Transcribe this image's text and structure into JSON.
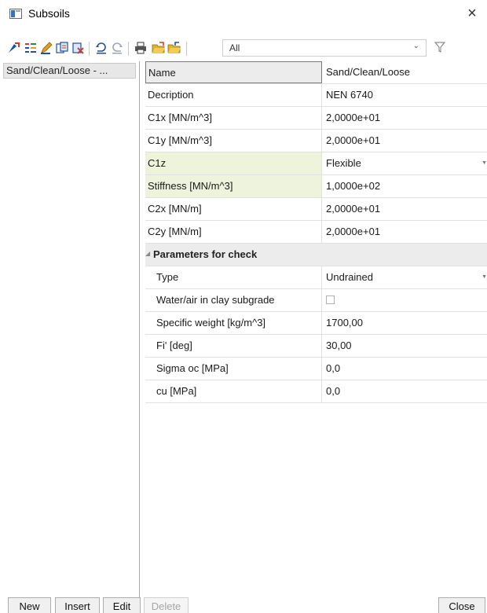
{
  "window": {
    "title": "Subsoils",
    "close_glyph": "×"
  },
  "toolbar": {
    "filter_value": "All",
    "filter_arrow": "⌄",
    "icons": [
      "new-icon",
      "properties-icon",
      "edit-icon",
      "copy-icon",
      "delete-icon",
      "undo-icon",
      "redo-icon",
      "print-icon",
      "open-icon",
      "save-icon",
      "filter-icon"
    ]
  },
  "list": {
    "items": [
      "Sand/Clean/Loose - ..."
    ]
  },
  "properties": {
    "rows": [
      {
        "name": "Name",
        "value": "Sand/Clean/Loose"
      },
      {
        "name": "Decription",
        "value": "NEN 6740"
      },
      {
        "name": "C1x [MN/m^3]",
        "value": "2,0000e+01"
      },
      {
        "name": "C1y [MN/m^3]",
        "value": "2,0000e+01"
      },
      {
        "name": "C1z",
        "value": "Flexible"
      },
      {
        "name": "Stiffness [MN/m^3]",
        "value": "1,0000e+02"
      },
      {
        "name": "C2x [MN/m]",
        "value": "2,0000e+01"
      },
      {
        "name": "C2y [MN/m]",
        "value": "2,0000e+01"
      }
    ],
    "group": {
      "label": "Parameters for check",
      "rows": [
        {
          "name": "Type",
          "value": "Undrained"
        },
        {
          "name": "Water/air in clay subgrade",
          "value": ""
        },
        {
          "name": "Specific weight [kg/m^3]",
          "value": "1700,00"
        },
        {
          "name": "Fi' [deg]",
          "value": "30,00"
        },
        {
          "name": "Sigma oc [MPa]",
          "value": "0,0"
        },
        {
          "name": "cu [MPa]",
          "value": "0,0"
        }
      ]
    }
  },
  "buttons": {
    "new": "New",
    "insert": "Insert",
    "edit": "Edit",
    "delete": "Delete",
    "close": "Close"
  },
  "colors": {
    "highlight_row": "#eef3dc",
    "group_header": "#ececec",
    "selected_list_item": "#e7e7e7"
  }
}
